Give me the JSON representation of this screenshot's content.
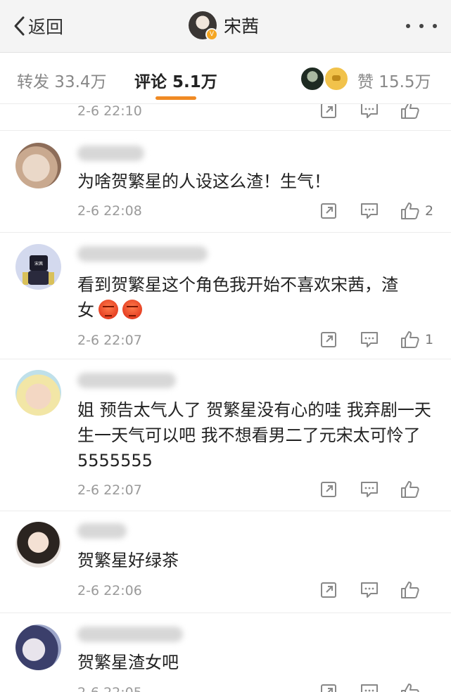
{
  "header": {
    "back_label": "返回",
    "title": "宋茜",
    "verified_badge": "V"
  },
  "tabs": {
    "repost": "转发 33.4万",
    "comments": "评论 5.1万",
    "likes": "赞 15.5万"
  },
  "colors": {
    "accent": "#f08a24",
    "badge": "#f5a623"
  },
  "comments": [
    {
      "text": "",
      "time": "2-6 22:10",
      "likes": ""
    },
    {
      "text": "为啥贺繁星的人设这么渣！生气！",
      "time": "2-6 22:08",
      "likes": "2"
    },
    {
      "text_line1": "看到贺繁星这个角色我开始不喜欢宋茜，渣",
      "text_line2": "女",
      "avatar_label": "宋茜",
      "time": "2-6 22:07",
      "likes": "1"
    },
    {
      "text": "姐 预告太气人了 贺繁星没有心的哇 我弃剧一天 生一天气可以吧 我不想看男二了元宋太可怜了5555555",
      "time": "2-6 22:07",
      "likes": ""
    },
    {
      "text": "贺繁星好绿茶",
      "time": "2-6 22:06",
      "likes": ""
    },
    {
      "text": "贺繁星渣女吧",
      "time": "2-6 22:05",
      "likes": ""
    }
  ],
  "icons": {
    "repost": "share-icon",
    "comment": "comment-icon",
    "like": "thumbs-up-icon"
  }
}
